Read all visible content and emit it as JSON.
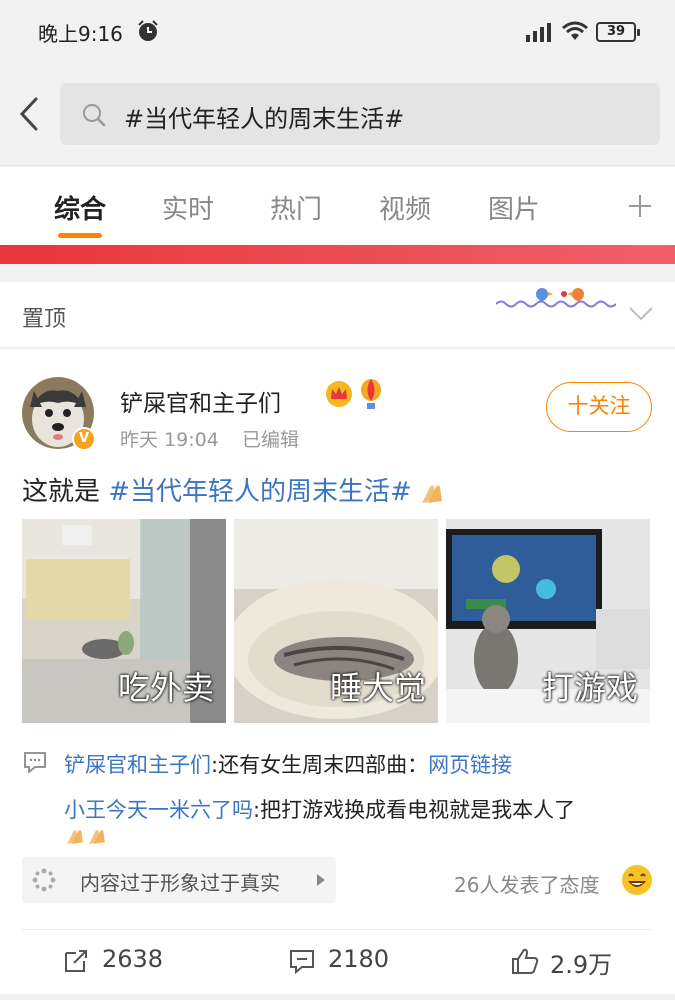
{
  "status_bar": {
    "time": "晚上9:16",
    "battery": "39"
  },
  "search": {
    "query": "#当代年轻人的周末生活#"
  },
  "tabs": [
    {
      "label": "综合",
      "active": true
    },
    {
      "label": "实时"
    },
    {
      "label": "热门"
    },
    {
      "label": "视频"
    },
    {
      "label": "图片"
    }
  ],
  "pinned": {
    "label": "置顶"
  },
  "post": {
    "author": "铲屎官和主子们",
    "time": "昨天 19:04",
    "edited": "已编辑",
    "follow_label": "十关注",
    "text_prefix": "这就是 ",
    "hashtag": "#当代年轻人的周末生活#",
    "photos": [
      {
        "caption": "吃外卖"
      },
      {
        "caption": "睡大觉"
      },
      {
        "caption": "打游戏"
      }
    ],
    "comments": [
      {
        "user": "铲屎官和主子们",
        "text": ":还有女生周末四部曲：",
        "link": "网页链接"
      },
      {
        "user": "小王今天一米六了吗",
        "text": ":把打游戏换成看电视就是我本人了"
      }
    ],
    "topic_chip": "内容过于形象过于真实",
    "reactions_text": "26人发表了态度",
    "actions": {
      "reposts": "2638",
      "comments": "2180",
      "likes": "2.9万"
    }
  },
  "colors": {
    "accent": "#ff8200",
    "link": "#3b75c4",
    "banner": "#e8363c"
  }
}
